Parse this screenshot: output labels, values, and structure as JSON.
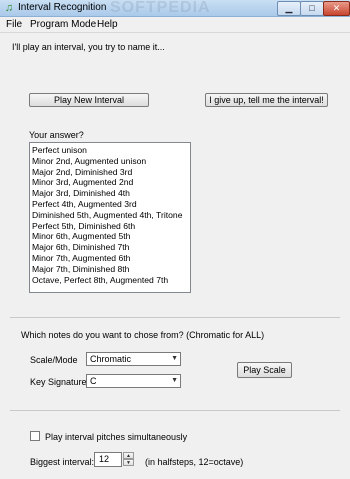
{
  "window": {
    "title": "Interval Recognition",
    "watermark": "SOFTPEDIA",
    "controls": {
      "minimize": "▁",
      "maximize": "□",
      "close": "✕"
    }
  },
  "menu": [
    "File",
    "Program Mode",
    "Help"
  ],
  "instructions": "I'll play an interval, you try to name it...",
  "buttons": {
    "play_new_interval": "Play New Interval",
    "give_up": "I give up, tell me the interval!",
    "play_scale": "Play Scale"
  },
  "answer": {
    "label": "Your answer?",
    "items": [
      "Perfect unison",
      "Minor 2nd, Augmented unison",
      "Major 2nd, Diminished 3rd",
      "Minor 3rd, Augmented 2nd",
      "Major 3rd, Diminished 4th",
      "Perfect 4th, Augmented 3rd",
      "Diminished 5th, Augmented 4th, Tritone",
      "Perfect 5th, Diminished 6th",
      "Minor 6th, Augmented 5th",
      "Major 6th, Diminished 7th",
      "Minor 7th, Augmented 6th",
      "Major 7th, Diminished 8th",
      "Octave, Perfect 8th, Augmented 7th"
    ]
  },
  "notes": {
    "label": "Which notes do you want to chose from?  (Chromatic for ALL)",
    "scale_mode_label": "Scale/Mode",
    "scale_mode_value": "Chromatic",
    "key_signature_label": "Key Signature",
    "key_signature_value": "C"
  },
  "options": {
    "simultaneous_label": "Play interval pitches simultaneously",
    "simultaneous_checked": false,
    "biggest_interval_label": "Biggest interval:",
    "biggest_interval_value": "12",
    "biggest_interval_hint": "(in halfsteps, 12=octave)"
  },
  "icons": {
    "app": "music-note-icon",
    "dropdown": "chevron-down-icon",
    "spin_up": "arrow-up-icon",
    "spin_down": "arrow-down-icon"
  }
}
